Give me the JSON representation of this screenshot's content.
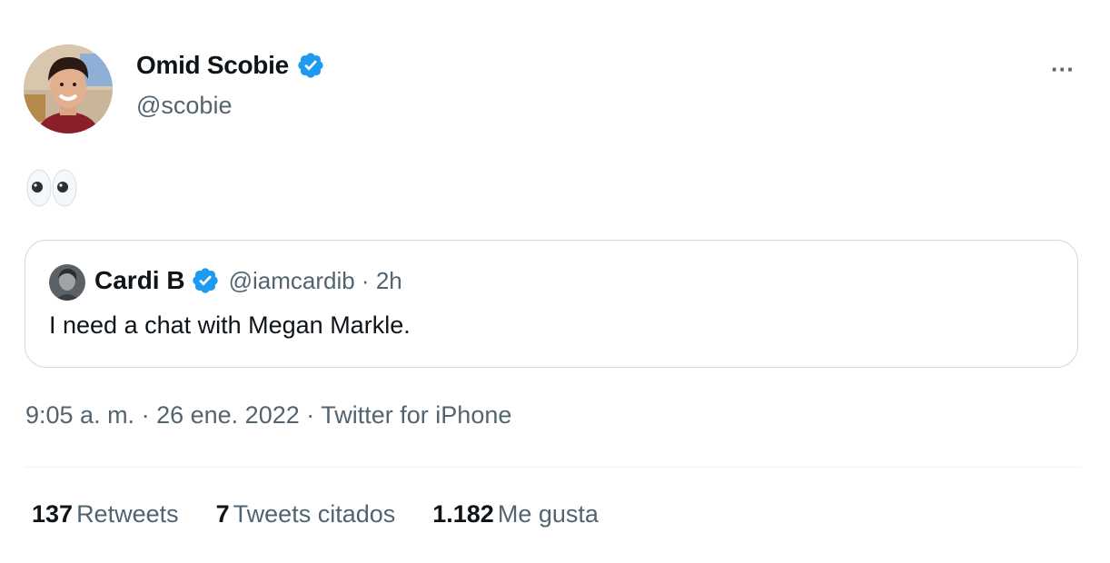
{
  "author": {
    "display_name": "Omid Scobie",
    "handle": "@scobie",
    "verified": true
  },
  "tweet": {
    "text": "👀"
  },
  "quoted_tweet": {
    "display_name": "Cardi B",
    "handle": "@iamcardib",
    "time": "2h",
    "verified": true,
    "text": "I need a chat with Megan Markle."
  },
  "meta": {
    "time": "9:05 a. m.",
    "date": "26 ene. 2022",
    "source": "Twitter for iPhone"
  },
  "stats": [
    {
      "count": "137",
      "label": "Retweets"
    },
    {
      "count": "7",
      "label": "Tweets citados"
    },
    {
      "count": "1.182",
      "label": "Me gusta"
    }
  ],
  "colors": {
    "verified_badge": "#1d9bf0",
    "secondary_text": "#536471",
    "border": "#cfd9de"
  }
}
